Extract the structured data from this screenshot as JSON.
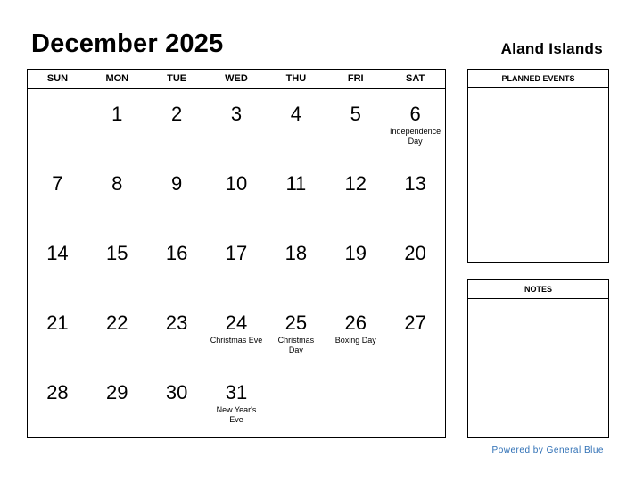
{
  "header": {
    "title": "December 2025",
    "region": "Aland Islands"
  },
  "calendar": {
    "weekdays": [
      "SUN",
      "MON",
      "TUE",
      "WED",
      "THU",
      "FRI",
      "SAT"
    ],
    "weeks": [
      [
        {
          "day": "",
          "event": ""
        },
        {
          "day": "1",
          "event": ""
        },
        {
          "day": "2",
          "event": ""
        },
        {
          "day": "3",
          "event": ""
        },
        {
          "day": "4",
          "event": ""
        },
        {
          "day": "5",
          "event": ""
        },
        {
          "day": "6",
          "event": "Independence Day"
        }
      ],
      [
        {
          "day": "7",
          "event": ""
        },
        {
          "day": "8",
          "event": ""
        },
        {
          "day": "9",
          "event": ""
        },
        {
          "day": "10",
          "event": ""
        },
        {
          "day": "11",
          "event": ""
        },
        {
          "day": "12",
          "event": ""
        },
        {
          "day": "13",
          "event": ""
        }
      ],
      [
        {
          "day": "14",
          "event": ""
        },
        {
          "day": "15",
          "event": ""
        },
        {
          "day": "16",
          "event": ""
        },
        {
          "day": "17",
          "event": ""
        },
        {
          "day": "18",
          "event": ""
        },
        {
          "day": "19",
          "event": ""
        },
        {
          "day": "20",
          "event": ""
        }
      ],
      [
        {
          "day": "21",
          "event": ""
        },
        {
          "day": "22",
          "event": ""
        },
        {
          "day": "23",
          "event": ""
        },
        {
          "day": "24",
          "event": "Christmas Eve"
        },
        {
          "day": "25",
          "event": "Christmas Day"
        },
        {
          "day": "26",
          "event": "Boxing Day"
        },
        {
          "day": "27",
          "event": ""
        }
      ],
      [
        {
          "day": "28",
          "event": ""
        },
        {
          "day": "29",
          "event": ""
        },
        {
          "day": "30",
          "event": ""
        },
        {
          "day": "31",
          "event": "New Year's Eve"
        },
        {
          "day": "",
          "event": ""
        },
        {
          "day": "",
          "event": ""
        },
        {
          "day": "",
          "event": ""
        }
      ]
    ]
  },
  "panels": {
    "planned_events": "PLANNED EVENTS",
    "notes": "NOTES"
  },
  "footer": {
    "link": "Powered by General Blue"
  }
}
